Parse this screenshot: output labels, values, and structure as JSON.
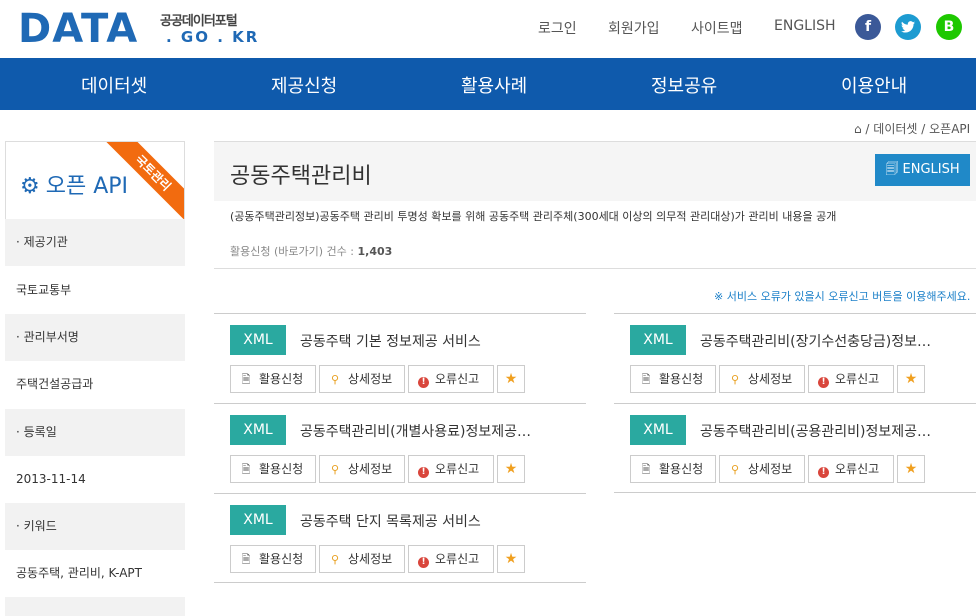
{
  "header": {
    "logo_big": "DATA",
    "logo_small1": "공공데이터포털",
    "logo_small2": ". GO . KR",
    "links": [
      "로그인",
      "회원가입",
      "사이트맵",
      "ENGLISH"
    ],
    "social": [
      "f",
      "t",
      "B"
    ]
  },
  "nav": [
    "데이터셋",
    "제공신청",
    "활용사례",
    "정보공유",
    "이용안내"
  ],
  "breadcrumb": "⌂ /  데이터셋  /  오픈API",
  "sidebar": {
    "title": "오픈 API",
    "ribbon": "국토관리",
    "rows": [
      {
        "label": "· 제공기관",
        "value": "국토교통부"
      },
      {
        "label": "· 관리부서명",
        "value": "주택건설공급과"
      },
      {
        "label": "· 등록일",
        "value": "2013-11-14"
      },
      {
        "label": "· 키워드",
        "value": "공동주택, 관리비, K-APT"
      }
    ]
  },
  "content": {
    "title": "공동주택관리비",
    "english_button": "ENGLISH",
    "description": "(공동주택관리정보)공동주택 관리비 투명성 확보를 위해 공동주택 관리주체(300세대 이상의 의무적 관리대상)가 관리비 내용을 공개",
    "count_label": "활용신청 (바로가기) 건수 : ",
    "count_value": "1,403",
    "notice": "※ 서비스 오류가 있을시 오류신고 버튼을 이용해주세요.",
    "buttons": {
      "apply": "활용신청",
      "detail": "상세정보",
      "report": "오류신고",
      "star": "★"
    },
    "apis": [
      {
        "format": "XML",
        "name": "공동주택 기본 정보제공 서비스"
      },
      {
        "format": "XML",
        "name": "공동주택관리비(장기수선충당금)정보…"
      },
      {
        "format": "XML",
        "name": "공동주택관리비(개별사용료)정보제공…"
      },
      {
        "format": "XML",
        "name": "공동주택관리비(공용관리비)정보제공…"
      },
      {
        "format": "XML",
        "name": "공동주택 단지 목록제공 서비스"
      }
    ]
  },
  "colors": {
    "brand": "#1f69b5",
    "nav": "#0f5aac",
    "xml": "#2aa9a0",
    "ribbon": "#f26b0f",
    "english": "#2089c8"
  }
}
